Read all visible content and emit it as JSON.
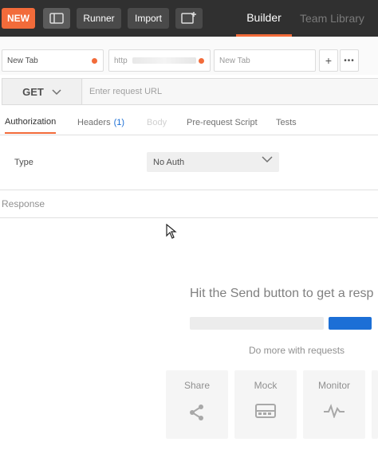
{
  "topbar": {
    "new_label": "NEW",
    "runner_label": "Runner",
    "import_label": "Import",
    "builder_label": "Builder",
    "team_library_label": "Team Library"
  },
  "request_tabs": [
    {
      "label": "New Tab"
    },
    {
      "label": "http"
    },
    {
      "label": "New Tab"
    }
  ],
  "request": {
    "method": "GET",
    "url_placeholder": "Enter request URL"
  },
  "subtabs": {
    "authorization": "Authorization",
    "headers": "Headers",
    "headers_count": "(1)",
    "body": "Body",
    "prerequest": "Pre-request Script",
    "tests": "Tests"
  },
  "auth": {
    "type_label": "Type",
    "type_value": "No Auth"
  },
  "response": {
    "title": "Response",
    "hint": "Hit the Send button to get a resp",
    "do_more": "Do more with requests",
    "cards": [
      {
        "label": "Share"
      },
      {
        "label": "Mock"
      },
      {
        "label": "Monitor"
      }
    ]
  },
  "colors": {
    "accent": "#f26b3a",
    "topbar": "#303030",
    "send_blue": "#1c6fd6"
  }
}
